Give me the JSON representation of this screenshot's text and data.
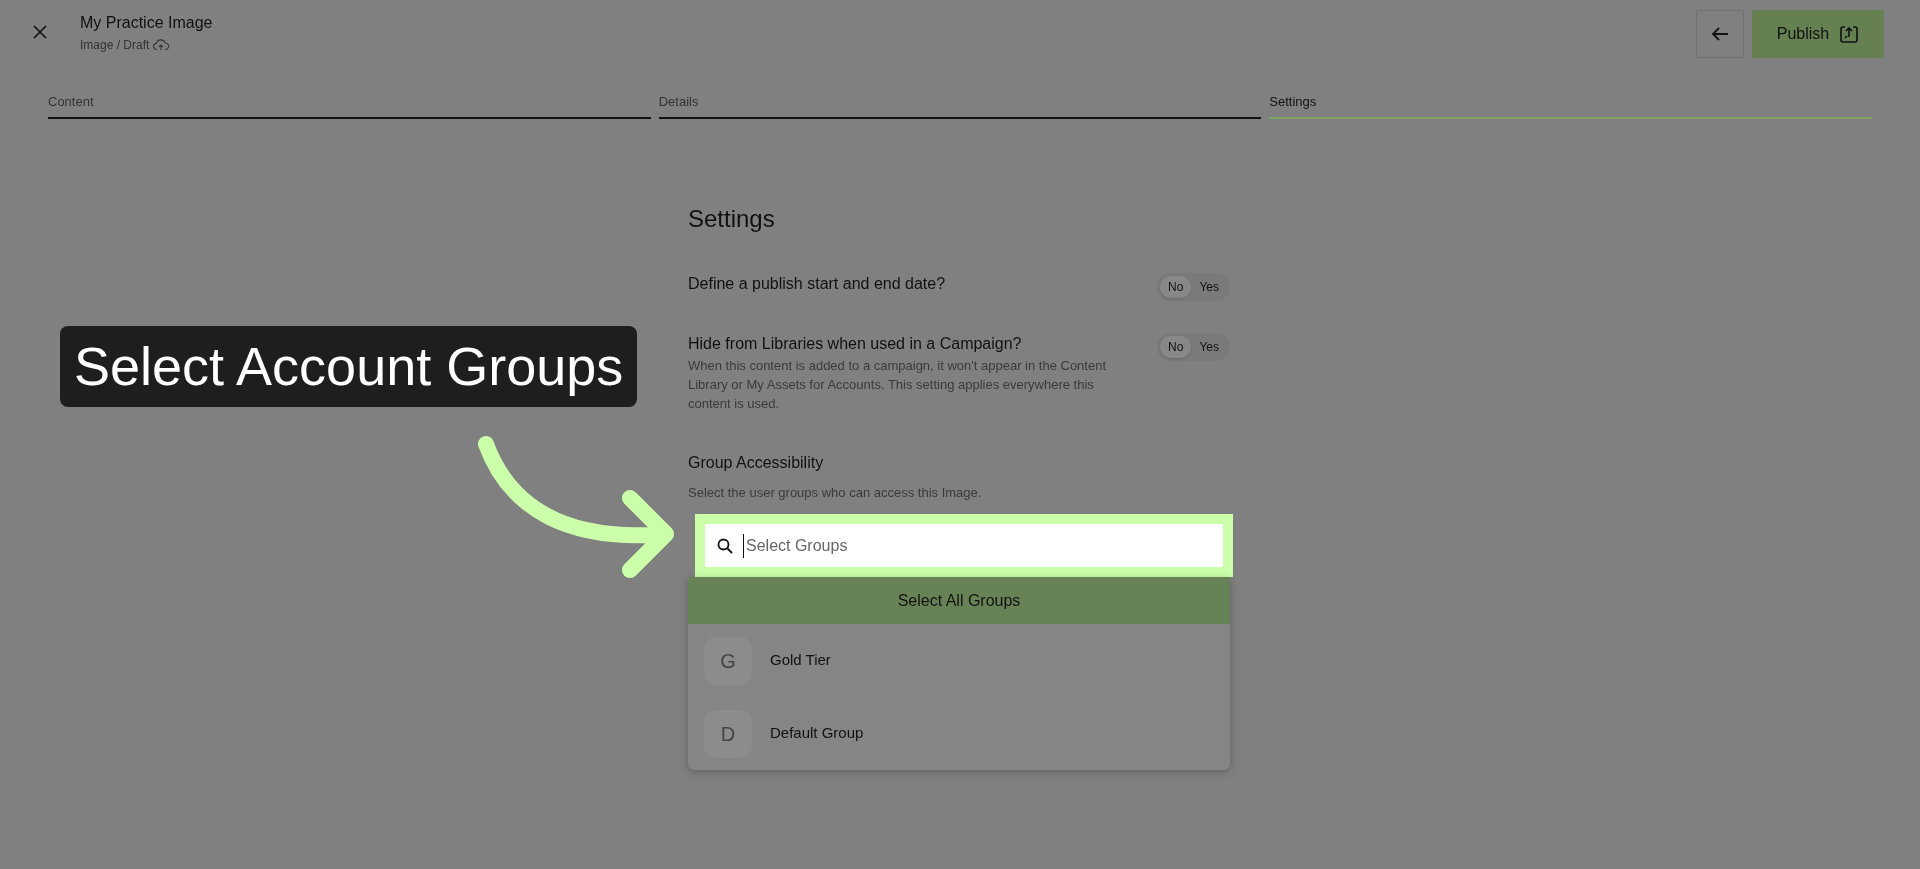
{
  "header": {
    "title": "My Practice Image",
    "breadcrumb": "Image / Draft",
    "publish_label": "Publish"
  },
  "tabs": [
    {
      "label": "Content",
      "selected": false
    },
    {
      "label": "Details",
      "selected": false
    },
    {
      "label": "Settings",
      "selected": true
    }
  ],
  "settings": {
    "title": "Settings",
    "rows": [
      {
        "label": "Define a publish start and end date?",
        "options": [
          {
            "label": "No",
            "selected": true
          },
          {
            "label": "Yes",
            "selected": false
          }
        ]
      },
      {
        "label": "Hide from Libraries when used in a Campaign?",
        "description": "When this content is added to a campaign, it won't appear in the Content Library or My Assets for Accounts. This setting applies everywhere this content is used.",
        "options": [
          {
            "label": "No",
            "selected": true
          },
          {
            "label": "Yes",
            "selected": false
          }
        ]
      }
    ],
    "group_accessibility": {
      "title": "Group Accessibility",
      "help": "Select the user groups who can access this Image.",
      "search": {
        "placeholder": "Select Groups"
      },
      "select_all": "Select All Groups",
      "groups": [
        {
          "initial": "G",
          "name": "Gold Tier"
        },
        {
          "initial": "D",
          "name": "Default Group"
        }
      ]
    }
  },
  "callout": {
    "text": "Select Account Groups"
  }
}
